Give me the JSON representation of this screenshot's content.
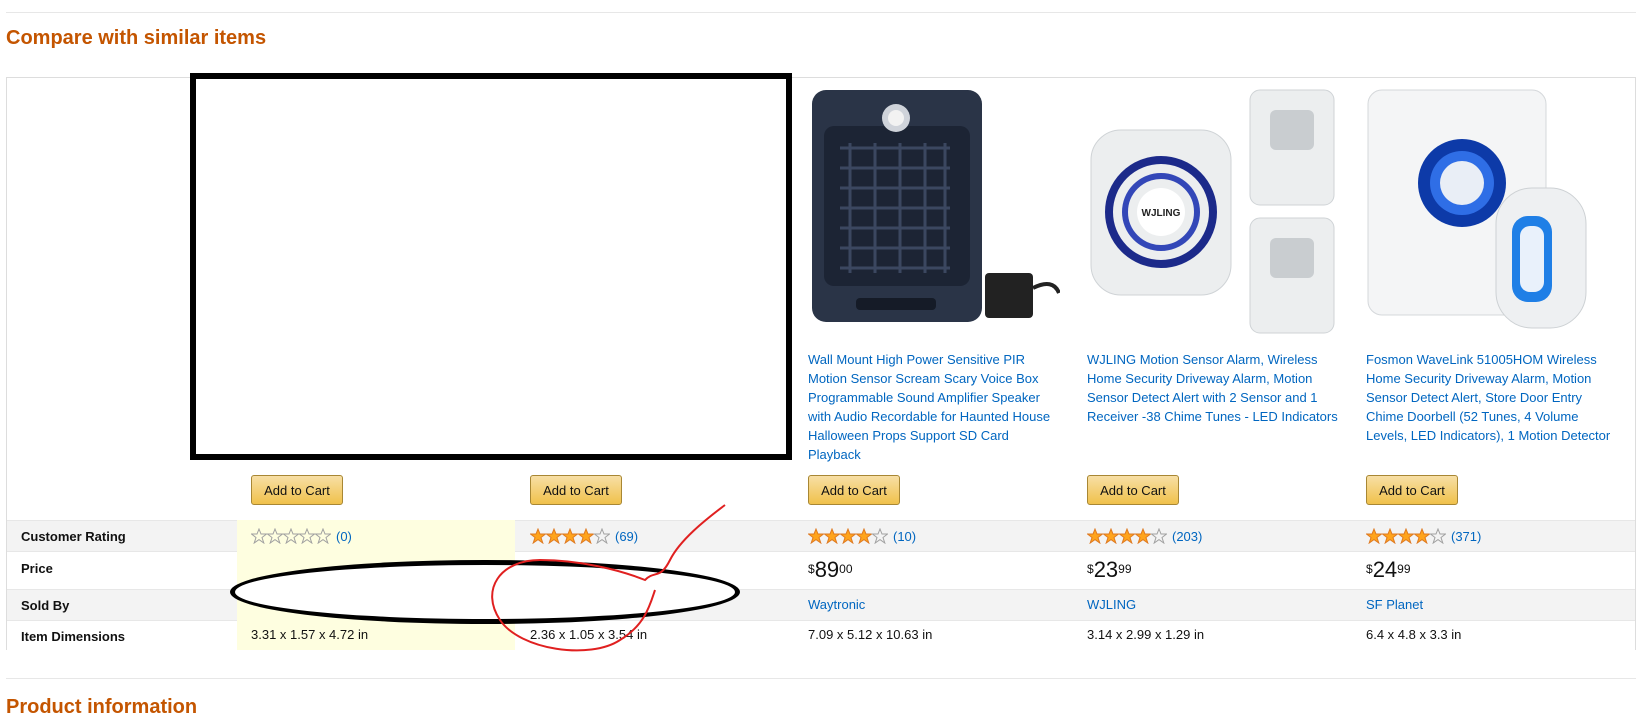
{
  "section_titles": {
    "compare": "Compare with similar items",
    "product_information": "Product information"
  },
  "row_labels": {
    "rating": "Customer Rating",
    "price": "Price",
    "sold_by": "Sold By",
    "dimensions": "Item Dimensions"
  },
  "products": [
    {
      "title": "",
      "add_to_cart": "Add to Cart",
      "rating_stars": 0,
      "rating_count": "(0)",
      "price_symbol": "",
      "price_whole": "",
      "price_fraction": "",
      "sold_by": "",
      "dimensions": "3.31 x 1.57 x 4.72 in"
    },
    {
      "title": "",
      "add_to_cart": "Add to Cart",
      "rating_stars": 4,
      "rating_count": "(69)",
      "price_symbol": "",
      "price_whole": "",
      "price_fraction": "",
      "sold_by": "",
      "dimensions": "2.36 x 1.05 x 3.54 in"
    },
    {
      "title": "Wall Mount High Power Sensitive PIR Motion Sensor Scream Scary Voice Box Programmable Sound Amplifier Speaker with Audio Recordable for Haunted House Halloween Props Support SD Card Playback",
      "add_to_cart": "Add to Cart",
      "rating_stars": 4,
      "rating_count": "(10)",
      "price_symbol": "$",
      "price_whole": "89",
      "price_fraction": "00",
      "sold_by": "Waytronic",
      "dimensions": "7.09 x 5.12 x 10.63 in"
    },
    {
      "title": "WJLING Motion Sensor Alarm, Wireless Home Security Driveway Alarm, Motion Sensor Detect Alert with 2 Sensor and 1 Receiver -38 Chime Tunes - LED Indicators",
      "add_to_cart": "Add to Cart",
      "rating_stars": 4,
      "rating_count": "(203)",
      "price_symbol": "$",
      "price_whole": "23",
      "price_fraction": "99",
      "sold_by": "WJLING",
      "dimensions": "3.14 x 2.99 x 1.29 in"
    },
    {
      "title": "Fosmon WaveLink 51005HOM Wireless Home Security Driveway Alarm, Motion Sensor Detect Alert, Store Door Entry Chime Doorbell (52 Tunes, 4 Volume Levels, LED Indicators), 1 Motion Detector",
      "add_to_cart": "Add to Cart",
      "rating_stars": 4,
      "rating_count": "(371)",
      "price_symbol": "$",
      "price_whole": "24",
      "price_fraction": "99",
      "sold_by": "SF Planet",
      "dimensions": "6.4 x 4.8 x 3.3 in"
    }
  ],
  "colors": {
    "section_title": "#c45500",
    "link": "#0066c0",
    "star": "#ffa41c",
    "button": "#f0c14b",
    "highlight": "#fefee0",
    "redaction": "#000000",
    "scribble": "#e02020"
  },
  "product_images": [
    "",
    "",
    "speaker-box",
    "wjling-alarm-kit",
    "fosmon-wavelink-kit"
  ],
  "wjling_logo_text": "WJLING"
}
